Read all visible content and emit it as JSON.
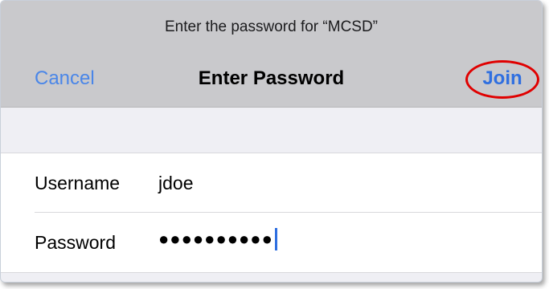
{
  "dialog": {
    "prompt": "Enter the password for “MCSD”",
    "title": "Enter Password",
    "cancel_label": "Cancel",
    "join_label": "Join"
  },
  "form": {
    "username": {
      "label": "Username",
      "value": "jdoe"
    },
    "password": {
      "label": "Password",
      "masked_value": "●●●●●●●●●●"
    }
  },
  "colors": {
    "accent": "#4a86e8",
    "highlight_circle": "#e00000",
    "navbar": "#c9c9cc",
    "background": "#efeff4"
  }
}
